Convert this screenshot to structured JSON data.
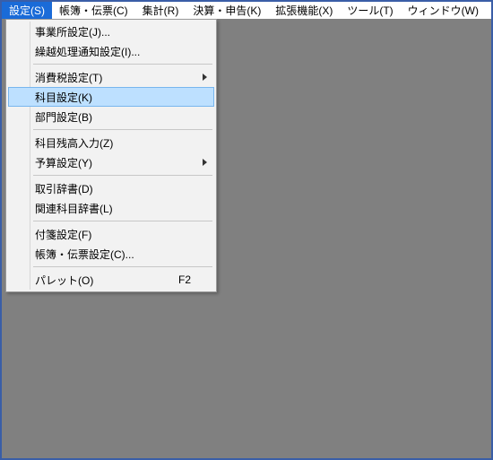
{
  "menubar": {
    "items": [
      {
        "label": "設定(S)",
        "selected": true
      },
      {
        "label": "帳簿・伝票(C)",
        "selected": false
      },
      {
        "label": "集計(R)",
        "selected": false
      },
      {
        "label": "決算・申告(K)",
        "selected": false
      },
      {
        "label": "拡張機能(X)",
        "selected": false
      },
      {
        "label": "ツール(T)",
        "selected": false
      },
      {
        "label": "ウィンドウ(W)",
        "selected": false
      }
    ]
  },
  "dropdown": {
    "items": [
      {
        "label": "事業所設定(J)...",
        "submenu": false,
        "highlight": false
      },
      {
        "label": "繰越処理通知設定(I)...",
        "submenu": false,
        "highlight": false
      },
      {
        "sep": true
      },
      {
        "label": "消費税設定(T)",
        "submenu": true,
        "highlight": false
      },
      {
        "label": "科目設定(K)",
        "submenu": false,
        "highlight": true
      },
      {
        "label": "部門設定(B)",
        "submenu": false,
        "highlight": false
      },
      {
        "sep": true
      },
      {
        "label": "科目残高入力(Z)",
        "submenu": false,
        "highlight": false
      },
      {
        "label": "予算設定(Y)",
        "submenu": true,
        "highlight": false
      },
      {
        "sep": true
      },
      {
        "label": "取引辞書(D)",
        "submenu": false,
        "highlight": false
      },
      {
        "label": "関連科目辞書(L)",
        "submenu": false,
        "highlight": false
      },
      {
        "sep": true
      },
      {
        "label": "付箋設定(F)",
        "submenu": false,
        "highlight": false
      },
      {
        "label": "帳簿・伝票設定(C)...",
        "submenu": false,
        "highlight": false
      },
      {
        "sep": true
      },
      {
        "label": "パレット(O)",
        "submenu": false,
        "highlight": false,
        "shortcut": "F2"
      }
    ]
  }
}
